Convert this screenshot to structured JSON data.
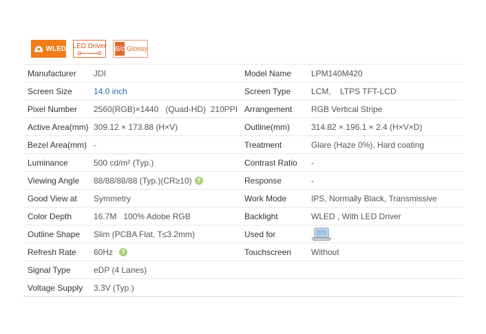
{
  "badges": {
    "wled": "WLED",
    "led_driver": "LED Driver",
    "glossy": "Glossy",
    "glossy_mark": "B/c"
  },
  "rows": [
    {
      "l1": "Manufacturer",
      "v1": "JDI",
      "l2": "Model Name",
      "v2": "LPM140M420"
    },
    {
      "l1": "Screen Size",
      "v1": "14.0 inch",
      "l2": "Screen Type",
      "v2": "LCM,    LTPS TFT-LCD"
    },
    {
      "l1": "Pixel Number",
      "v1": "2560(RGB)×1440   (Quad-HD)  210PPI",
      "l2": "Arrangement",
      "v2": "RGB Vertical Stripe"
    },
    {
      "l1": "Active Area(mm)",
      "v1": "309.12 × 173.88 (H×V)",
      "l2": "Outline(mm)",
      "v2": "314.82 × 196.1 × 2.4 (H×V×D)"
    },
    {
      "l1": "Bezel Area(mm)",
      "v1": "-",
      "l2": "Treatment",
      "v2": "Glare (Haze 0%), Hard coating"
    },
    {
      "l1": "Luminance",
      "v1": "500 cd/m² (Typ.)",
      "l2": "Contrast Ratio",
      "v2": "-"
    },
    {
      "l1": "Viewing Angle",
      "v1": "88/88/88/88 (Typ.)(CR≥10)",
      "l2": "Response",
      "v2": "-"
    },
    {
      "l1": "Good View at",
      "v1": "Symmetry",
      "l2": "Work Mode",
      "v2": "IPS, Normally Black, Transmissive"
    },
    {
      "l1": "Color Depth",
      "v1": "16.7M   100% Adobe RGB",
      "l2": "Backlight",
      "v2": "WLED , With LED Driver"
    },
    {
      "l1": "Outline Shape",
      "v1": "Slim (PCBA Flat, T≤3.2mm)",
      "l2": "Used for",
      "v2": ""
    },
    {
      "l1": "Refresh Rate",
      "v1": "60Hz",
      "l2": "Touchscreen",
      "v2": "Without"
    },
    {
      "l1": "Signal Type",
      "v1": "eDP (4 Lanes)"
    },
    {
      "l1": "Voltage Supply",
      "v1": "3.3V (Typ.)"
    }
  ],
  "help_mark": "?",
  "icons": {
    "wled": "bulb-icon",
    "driver": "led-driver-icon",
    "help": "question-mark-icon",
    "used_for": "laptop-icon"
  },
  "colors": {
    "accent_orange": "#f07c1a",
    "help_green": "#a9cf7a",
    "link_blue": "#2a66a8"
  }
}
